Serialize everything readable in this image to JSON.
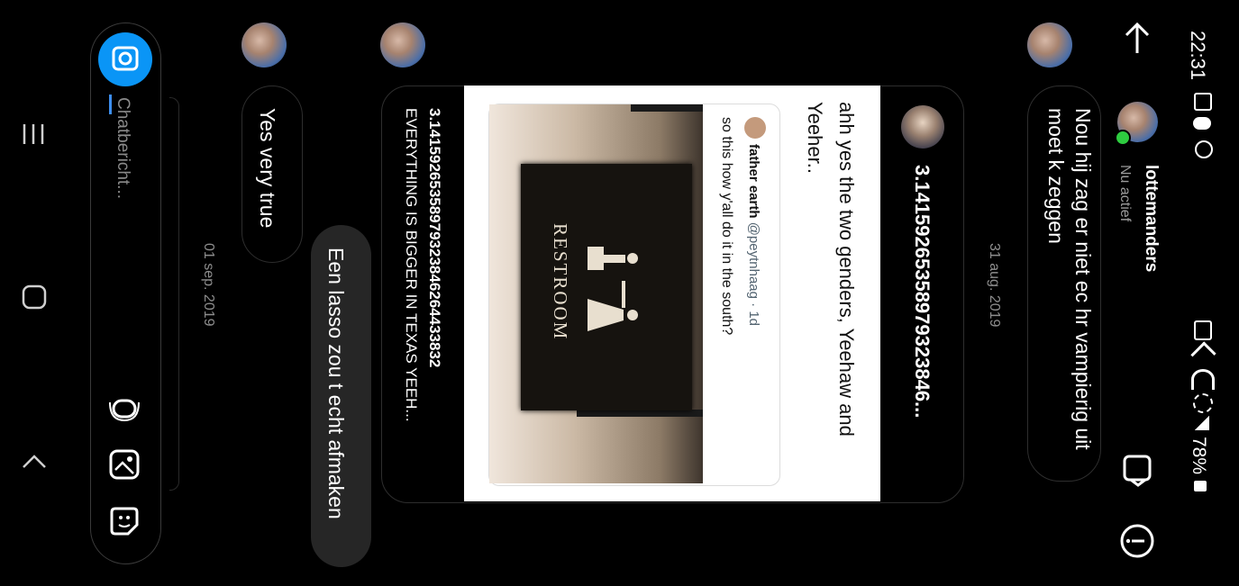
{
  "status_bar": {
    "time": "22:31",
    "battery": "78%",
    "icons": [
      "gallery-icon",
      "cloud-icon",
      "accessibility-icon",
      "battery-saver-icon",
      "mute-icon",
      "wifi-icon",
      "wifi-calling-icon",
      "signal-icon"
    ]
  },
  "header": {
    "username": "lottemanders",
    "status": "Nu actief",
    "icons": [
      "back-arrow-icon",
      "video-call-icon",
      "info-icon"
    ]
  },
  "messages": {
    "m1": "Nou hij zag er niet ec hr vampierig uit moet k zeggen",
    "date1": "31 aug. 2019",
    "shared_post": {
      "author": "3.14159265358979323846...",
      "caption": "ahh yes the two genders, Yeehaw and Yeeher..",
      "tweet_name": "father earth",
      "tweet_handle": "@peytnhaag · 1d",
      "tweet_text": "so this how y'all do it in the south?",
      "sign_text": "RESTROOM",
      "footer_author": "3.14159265358979323846264433832",
      "footer_text": "EVERYTHING IS BIGGER IN TEXAS YEEH..."
    },
    "m2": "Een lasso zou t echt afmaken",
    "m3": "Yes very true",
    "date2": "01 sep. 2019"
  },
  "composer": {
    "placeholder": "Chatbericht..."
  },
  "nav": {
    "icons": [
      "recents-icon",
      "home-icon",
      "back-icon"
    ]
  }
}
